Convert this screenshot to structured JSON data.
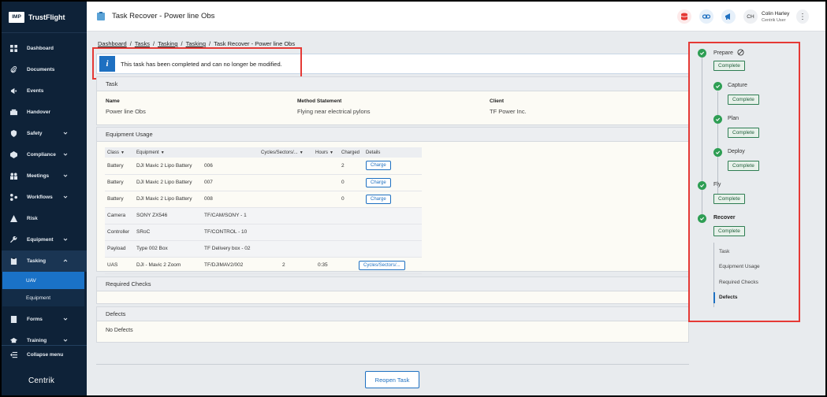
{
  "app": {
    "brand": "TrustFlight",
    "brand_logo_text": "IMP",
    "footer_logo": "Centrik"
  },
  "sidebar": {
    "items": [
      {
        "label": "Dashboard",
        "icon": "dashboard-icon",
        "has_submenu": false
      },
      {
        "label": "Documents",
        "icon": "paperclip-icon",
        "has_submenu": false
      },
      {
        "label": "Events",
        "icon": "megaphone-icon",
        "has_submenu": false
      },
      {
        "label": "Handover",
        "icon": "handover-icon",
        "has_submenu": false
      },
      {
        "label": "Safety",
        "icon": "shield-icon",
        "has_submenu": true
      },
      {
        "label": "Compliance",
        "icon": "compliance-icon",
        "has_submenu": true
      },
      {
        "label": "Meetings",
        "icon": "meetings-icon",
        "has_submenu": true
      },
      {
        "label": "Workflows",
        "icon": "workflows-icon",
        "has_submenu": true
      },
      {
        "label": "Risk",
        "icon": "warning-icon",
        "has_submenu": false
      },
      {
        "label": "Equipment",
        "icon": "wrench-icon",
        "has_submenu": true
      },
      {
        "label": "Tasking",
        "icon": "clipboard-icon",
        "has_submenu": true,
        "expanded": true
      }
    ],
    "tasking_subitems": [
      {
        "label": "UAV",
        "active": true
      },
      {
        "label": "Equipment",
        "active": false
      }
    ],
    "items_after": [
      {
        "label": "Forms",
        "icon": "forms-icon",
        "has_submenu": true
      },
      {
        "label": "Training",
        "icon": "graduation-cap-icon",
        "has_submenu": true
      }
    ],
    "collapse_label": "Collapse menu"
  },
  "header": {
    "title": "Task Recover - Power line Obs",
    "user": {
      "initials": "CH",
      "name": "Colin Harley",
      "role": "Centrik User"
    },
    "colors": {
      "database_icon": "#e53935",
      "link_icon": "#1e70c1",
      "megaphone_icon": "#1e70c1"
    }
  },
  "breadcrumb": {
    "items": [
      "Dashboard",
      "Tasks",
      "Tasking",
      "Tasking"
    ],
    "current": "Task Recover - Power line Obs"
  },
  "notice": {
    "message": "This task has been completed and can no longer be modified.",
    "icon_letter": "i"
  },
  "task_panel": {
    "title": "Task",
    "fields": [
      {
        "label": "Name",
        "value": "Power line Obs"
      },
      {
        "label": "Method Statement",
        "value": "Flying near electrical pylons"
      },
      {
        "label": "Client",
        "value": "TF Power Inc."
      }
    ]
  },
  "equipment_panel": {
    "title": "Equipment Usage",
    "columns": {
      "class": "Class",
      "equipment": "Equipment",
      "cycles": "Cycles/Sectors/...",
      "hours": "Hours",
      "charged": "Charged",
      "details": "Details"
    },
    "rows": [
      {
        "class": "Battery",
        "equipment": "DJI Mavic 2 Lipo Battery",
        "serial": "006",
        "cycles": "",
        "hours": "",
        "charged": "2",
        "action": "Charge"
      },
      {
        "class": "Battery",
        "equipment": "DJI Mavic 2 Lipo Battery",
        "serial": "007",
        "cycles": "",
        "hours": "",
        "charged": "0",
        "action": "Charge"
      },
      {
        "class": "Battery",
        "equipment": "DJI Mavic 2 Lipo Battery",
        "serial": "008",
        "cycles": "",
        "hours": "",
        "charged": "0",
        "action": "Charge"
      },
      {
        "class": "Camera",
        "equipment": "SONY ZX546",
        "serial": "TF/CAM/SONY - 1",
        "cycles": "",
        "hours": "",
        "charged": "",
        "action": ""
      },
      {
        "class": "Controller",
        "equipment": "SRoC",
        "serial": "TF/CONTROL - 10",
        "cycles": "",
        "hours": "",
        "charged": "",
        "action": ""
      },
      {
        "class": "Payload",
        "equipment": "Type 002 Box",
        "serial": "TF Delivery box - 02",
        "cycles": "",
        "hours": "",
        "charged": "",
        "action": ""
      },
      {
        "class": "UAS",
        "equipment": "DJI - Mavic 2 Zoom",
        "serial": "TF/DJIMAV2/002",
        "cycles": "2",
        "hours": "0:35",
        "charged": "",
        "action": "Cycles/Sectors/..."
      }
    ]
  },
  "checks_panel": {
    "title": "Required Checks"
  },
  "defects_panel": {
    "title": "Defects",
    "empty_text": "No Defects"
  },
  "reopen_label": "Reopen Task",
  "workflow": {
    "steps": [
      {
        "label": "Prepare",
        "status": "Complete"
      },
      {
        "label": "Capture",
        "status": "Complete"
      },
      {
        "label": "Plan",
        "status": "Complete"
      },
      {
        "label": "Deploy",
        "status": "Complete"
      },
      {
        "label": "Fly",
        "status": "Complete"
      },
      {
        "label": "Recover",
        "status": "Complete"
      }
    ],
    "sections": [
      "Task",
      "Equipment Usage",
      "Required Checks",
      "Defects"
    ],
    "active_section": "Defects",
    "colors": {
      "complete": "#2e9e54",
      "highlight": "#e53935"
    }
  }
}
